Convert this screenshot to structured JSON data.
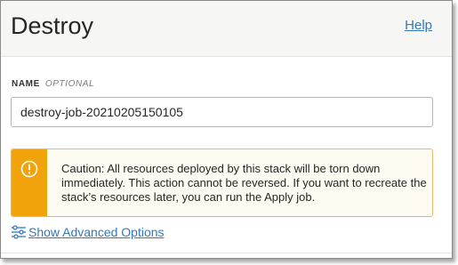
{
  "header": {
    "title": "Destroy",
    "help_label": "Help"
  },
  "name_field": {
    "label": "NAME",
    "optional_label": "OPTIONAL",
    "value": "destroy-job-20210205150105"
  },
  "caution": {
    "text": "Caution: All resources deployed by this stack will be torn down immediately. This action cannot be reversed. If you want to recreate the stack’s resources later, you can run the Apply job.",
    "icon": "exclamation-circle-icon",
    "accent_color": "#f0a30a"
  },
  "advanced": {
    "label": "Show Advanced Options",
    "icon": "sliders-icon"
  },
  "colors": {
    "link": "#2f79bb",
    "header_bg": "#f6f6f5"
  }
}
